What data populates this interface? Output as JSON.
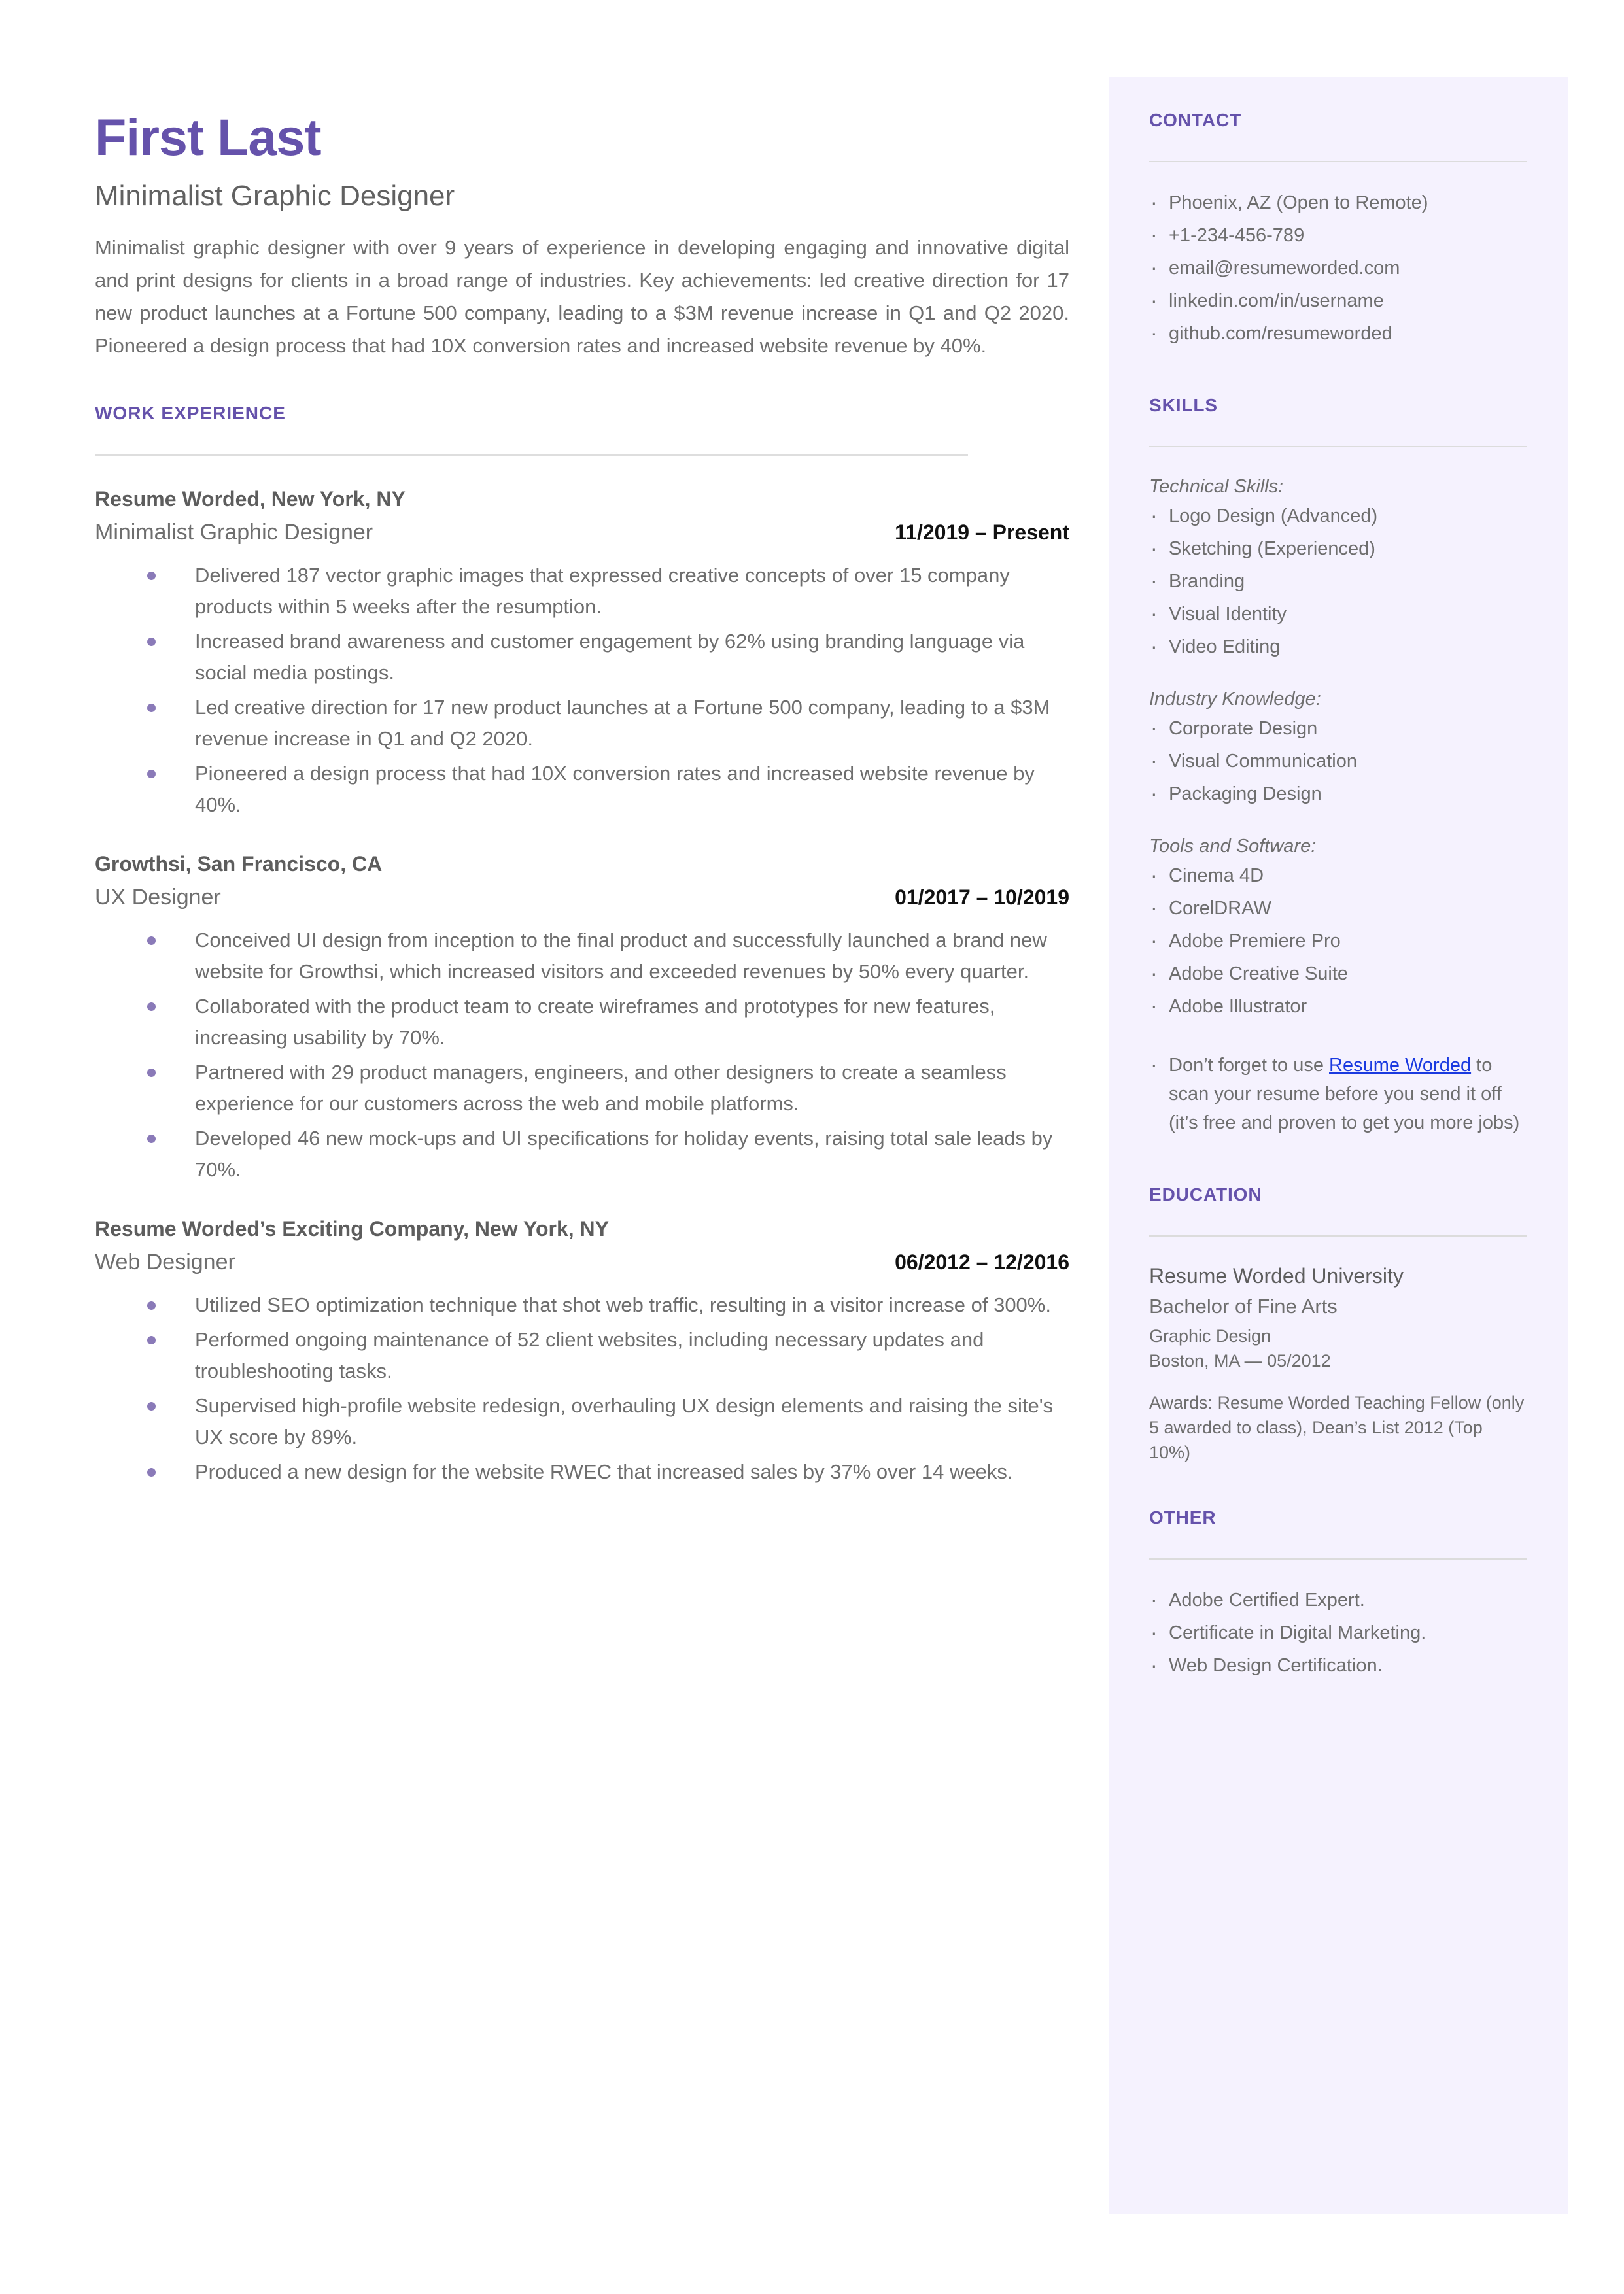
{
  "colors": {
    "accent_purple": "#6552ab",
    "bullet_purple": "#8a7ab8",
    "sidebar_background": "#f5f2fe",
    "link_blue": "#1a3ae0",
    "body_text": "#6e6e6e"
  },
  "header": {
    "name": "First Last",
    "job_title": "Minimalist Graphic Designer",
    "summary": "Minimalist graphic designer with over 9 years of experience in developing engaging and innovative digital and print designs for clients in a broad range of industries. Key achievements: led creative direction for 17 new product launches at a Fortune 500 company, leading to a $3M revenue increase in Q1 and Q2 2020. Pioneered a design process that had 10X conversion rates and increased website revenue by 40%."
  },
  "work_experience": {
    "heading": "WORK EXPERIENCE",
    "jobs": [
      {
        "company": "Resume Worded, New York, NY",
        "role": "Minimalist Graphic Designer",
        "dates": "11/2019 – Present",
        "bullets": [
          "Delivered 187 vector graphic images that expressed creative concepts of over 15 company products within 5 weeks after the resumption.",
          "Increased brand awareness and customer engagement by 62% using branding language via social media postings.",
          "Led creative direction for 17 new product launches at a Fortune 500 company, leading to a $3M revenue increase in Q1 and Q2 2020.",
          "Pioneered a design process that had 10X conversion rates and increased website revenue by 40%."
        ]
      },
      {
        "company": "Growthsi, San Francisco, CA",
        "role": "UX Designer",
        "dates": "01/2017 – 10/2019",
        "bullets": [
          "Conceived UI design from inception to the final product and successfully launched a brand new website for Growthsi, which increased visitors and exceeded revenues by 50% every quarter.",
          "Collaborated with the product team to create wireframes and prototypes for new features, increasing usability by 70%.",
          "Partnered with 29 product managers, engineers, and other designers to create a seamless experience for our customers across the web and mobile platforms.",
          "Developed 46 new mock-ups and UI specifications for holiday events, raising total sale leads by 70%."
        ]
      },
      {
        "company": "Resume Worded’s Exciting Company, New York, NY",
        "role": "Web Designer",
        "dates": "06/2012 – 12/2016",
        "bullets": [
          "Utilized SEO optimization technique that shot web traffic, resulting in a visitor increase of 300%.",
          "Performed ongoing maintenance of 52 client websites, including necessary updates and troubleshooting tasks.",
          "Supervised high-profile website redesign, overhauling UX design elements and raising the site's UX score by 89%.",
          "Produced a new design for the website RWEC that increased sales by 37% over 14 weeks."
        ]
      }
    ]
  },
  "contact": {
    "heading": "CONTACT",
    "items": [
      "Phoenix, AZ (Open to Remote)",
      "+1-234-456-789",
      "email@resumeworded.com",
      "linkedin.com/in/username",
      "github.com/resumeworded"
    ]
  },
  "skills": {
    "heading": "SKILLS",
    "groups": [
      {
        "label": "Technical Skills:",
        "items": [
          "Logo Design (Advanced)",
          "Sketching (Experienced)",
          "Branding",
          "Visual Identity",
          "Video Editing"
        ]
      },
      {
        "label": "Industry Knowledge:",
        "items": [
          "Corporate Design",
          "Visual Communication",
          "Packaging Design"
        ]
      },
      {
        "label": "Tools and Software:",
        "items": [
          "Cinema 4D",
          "CorelDRAW",
          "Adobe Premiere Pro",
          "Adobe Creative Suite",
          "Adobe Illustrator"
        ]
      }
    ],
    "promo": {
      "text_before": "Don’t forget to use ",
      "link_text": "Resume Worded",
      "text_after": " to scan your resume before you send it off (it’s free and proven to get you more jobs)"
    }
  },
  "education": {
    "heading": "EDUCATION",
    "school": "Resume Worded University",
    "degree": "Bachelor of Fine Arts",
    "field": "Graphic Design",
    "location_date": "Boston, MA — 05/2012",
    "awards": "Awards: Resume Worded Teaching Fellow (only 5 awarded to class), Dean’s List 2012 (Top 10%)"
  },
  "other": {
    "heading": "OTHER",
    "items": [
      "Adobe Certified Expert.",
      "Certificate in Digital Marketing.",
      "Web Design Certification."
    ]
  }
}
